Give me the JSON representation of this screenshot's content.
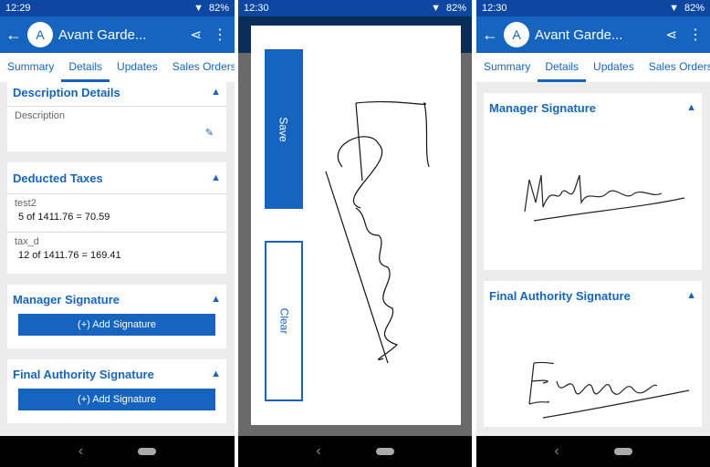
{
  "panels": [
    {
      "time": "12:29",
      "battery": "82%",
      "title": "Avant Garde...",
      "avatar": "A",
      "tabs": [
        "Summary",
        "Details",
        "Updates",
        "Sales Orders"
      ],
      "description": {
        "title": "Description Details",
        "label": "Description"
      },
      "taxes": {
        "title": "Deducted Taxes",
        "items": [
          {
            "name": "test2",
            "value": "5 of 1411.76 = 70.59"
          },
          {
            "name": "tax_d",
            "value": "12 of 1411.76 = 169.41"
          }
        ]
      },
      "manager": {
        "title": "Manager Signature",
        "button": "(+) Add Signature"
      },
      "final": {
        "title": "Final Authority Signature",
        "button": "(+) Add Signature"
      }
    },
    {
      "time": "12:30",
      "battery": "82%",
      "save": "Save",
      "clear": "Clear"
    },
    {
      "time": "12:30",
      "battery": "82%",
      "title": "Avant Garde...",
      "avatar": "A",
      "tabs": [
        "Summary",
        "Details",
        "Updates",
        "Sales Orders"
      ],
      "manager": {
        "title": "Manager Signature"
      },
      "final": {
        "title": "Final Authority Signature"
      }
    }
  ],
  "colors": {
    "primary": "#1565c0",
    "statusbar": "#0d47a1"
  }
}
